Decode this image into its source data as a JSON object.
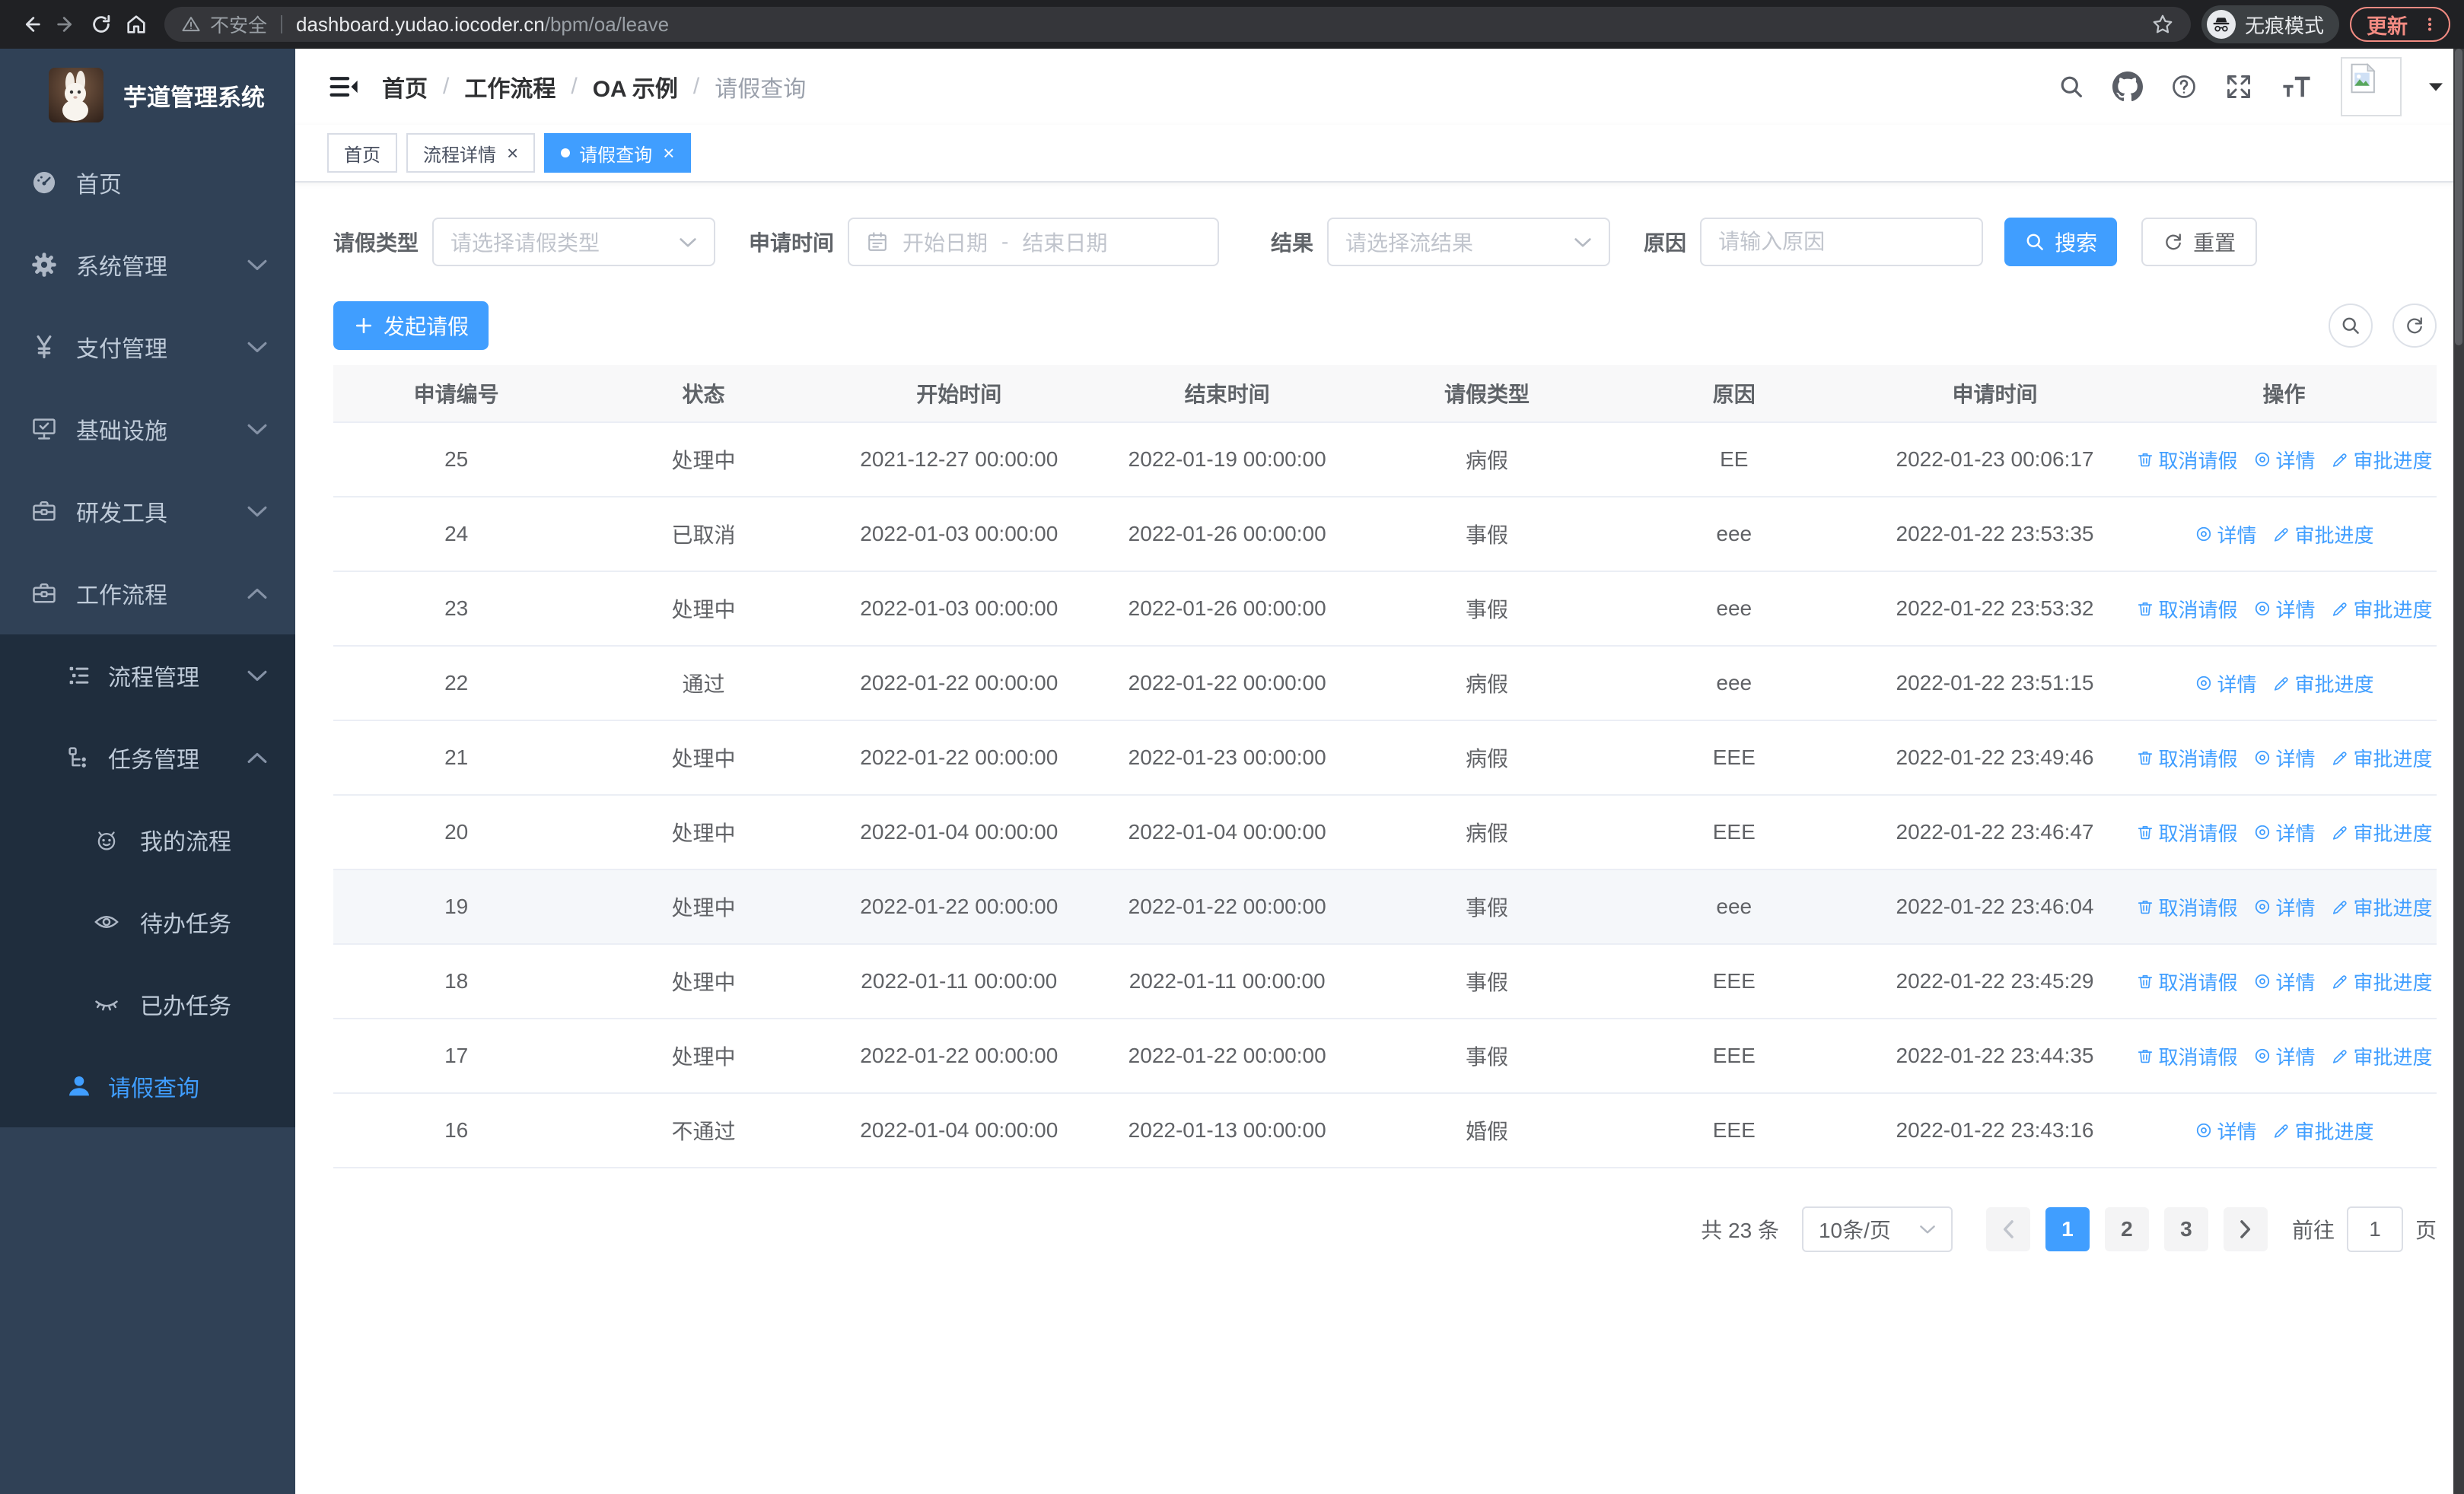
{
  "colors": {
    "primary": "#409eff",
    "sidebar_bg": "#304156",
    "sidebar_submenu_bg": "#1f2d3d",
    "update_accent": "#f28b82",
    "table_header_bg": "#f8f8f9",
    "row_highlight": "#f5f7fa",
    "link": "#409eff"
  },
  "browser": {
    "security_label": "不安全",
    "url_domain": "dashboard.yudao.iocoder.cn",
    "url_path": "/bpm/oa/leave",
    "incognito_label": "无痕模式",
    "update_label": "更新"
  },
  "sidebar": {
    "title": "芋道管理系统",
    "menu": [
      {
        "label": "首页",
        "icon": "dashboard",
        "level": 1
      },
      {
        "label": "系统管理",
        "icon": "gear",
        "level": 1,
        "chevron": "down"
      },
      {
        "label": "支付管理",
        "icon": "yen",
        "level": 1,
        "chevron": "down"
      },
      {
        "label": "基础设施",
        "icon": "monitor",
        "level": 1,
        "chevron": "down"
      },
      {
        "label": "研发工具",
        "icon": "toolbox",
        "level": 1,
        "chevron": "down"
      },
      {
        "label": "工作流程",
        "icon": "toolbox",
        "level": 1,
        "chevron": "up"
      },
      {
        "label": "流程管理",
        "icon": "list",
        "level": 2,
        "sub": true,
        "chevron": "down"
      },
      {
        "label": "任务管理",
        "icon": "tree",
        "level": 2,
        "sub": true,
        "chevron": "up"
      },
      {
        "label": "我的流程",
        "icon": "robot",
        "level": 3,
        "sub": true
      },
      {
        "label": "待办任务",
        "icon": "eye",
        "level": 3,
        "sub": true
      },
      {
        "label": "已办任务",
        "icon": "eye-closed",
        "level": 3,
        "sub": true
      },
      {
        "label": "请假查询",
        "icon": "user",
        "level": 2,
        "sub": true,
        "active": true
      }
    ]
  },
  "topbar": {
    "breadcrumb": [
      "首页",
      "工作流程",
      "OA 示例",
      "请假查询"
    ]
  },
  "tabs": [
    {
      "label": "首页"
    },
    {
      "label": "流程详情",
      "closable": true
    },
    {
      "label": "请假查询",
      "closable": true,
      "active": true
    }
  ],
  "filters": {
    "leave_type_label": "请假类型",
    "leave_type_placeholder": "请选择请假类型",
    "apply_time_label": "申请时间",
    "date_start_placeholder": "开始日期",
    "date_separator": "-",
    "date_end_placeholder": "结束日期",
    "result_label": "结果",
    "result_placeholder": "请选择流结果",
    "reason_label": "原因",
    "reason_placeholder": "请输入原因",
    "search_label": "搜索",
    "reset_label": "重置"
  },
  "toolbar": {
    "create_label": "发起请假"
  },
  "table": {
    "columns": [
      "申请编号",
      "状态",
      "开始时间",
      "结束时间",
      "请假类型",
      "原因",
      "申请时间",
      "操作"
    ],
    "action_labels": {
      "cancel": "取消请假",
      "detail": "详情",
      "progress": "审批进度"
    },
    "rows": [
      {
        "id": "25",
        "status": "处理中",
        "start": "2021-12-27 00:00:00",
        "end": "2022-01-19 00:00:00",
        "type": "病假",
        "reason": "EE",
        "apply_time": "2022-01-23 00:06:17",
        "actions": [
          "cancel",
          "detail",
          "progress"
        ]
      },
      {
        "id": "24",
        "status": "已取消",
        "start": "2022-01-03 00:00:00",
        "end": "2022-01-26 00:00:00",
        "type": "事假",
        "reason": "eee",
        "apply_time": "2022-01-22 23:53:35",
        "actions": [
          "detail",
          "progress"
        ]
      },
      {
        "id": "23",
        "status": "处理中",
        "start": "2022-01-03 00:00:00",
        "end": "2022-01-26 00:00:00",
        "type": "事假",
        "reason": "eee",
        "apply_time": "2022-01-22 23:53:32",
        "actions": [
          "cancel",
          "detail",
          "progress"
        ]
      },
      {
        "id": "22",
        "status": "通过",
        "start": "2022-01-22 00:00:00",
        "end": "2022-01-22 00:00:00",
        "type": "病假",
        "reason": "eee",
        "apply_time": "2022-01-22 23:51:15",
        "actions": [
          "detail",
          "progress"
        ]
      },
      {
        "id": "21",
        "status": "处理中",
        "start": "2022-01-22 00:00:00",
        "end": "2022-01-23 00:00:00",
        "type": "病假",
        "reason": "EEE",
        "apply_time": "2022-01-22 23:49:46",
        "actions": [
          "cancel",
          "detail",
          "progress"
        ]
      },
      {
        "id": "20",
        "status": "处理中",
        "start": "2022-01-04 00:00:00",
        "end": "2022-01-04 00:00:00",
        "type": "病假",
        "reason": "EEE",
        "apply_time": "2022-01-22 23:46:47",
        "actions": [
          "cancel",
          "detail",
          "progress"
        ]
      },
      {
        "id": "19",
        "status": "处理中",
        "start": "2022-01-22 00:00:00",
        "end": "2022-01-22 00:00:00",
        "type": "事假",
        "reason": "eee",
        "apply_time": "2022-01-22 23:46:04",
        "actions": [
          "cancel",
          "detail",
          "progress"
        ],
        "highlighted": true
      },
      {
        "id": "18",
        "status": "处理中",
        "start": "2022-01-11 00:00:00",
        "end": "2022-01-11 00:00:00",
        "type": "事假",
        "reason": "EEE",
        "apply_time": "2022-01-22 23:45:29",
        "actions": [
          "cancel",
          "detail",
          "progress"
        ]
      },
      {
        "id": "17",
        "status": "处理中",
        "start": "2022-01-22 00:00:00",
        "end": "2022-01-22 00:00:00",
        "type": "事假",
        "reason": "EEE",
        "apply_time": "2022-01-22 23:44:35",
        "actions": [
          "cancel",
          "detail",
          "progress"
        ]
      },
      {
        "id": "16",
        "status": "不通过",
        "start": "2022-01-04 00:00:00",
        "end": "2022-01-13 00:00:00",
        "type": "婚假",
        "reason": "EEE",
        "apply_time": "2022-01-22 23:43:16",
        "actions": [
          "detail",
          "progress"
        ]
      }
    ]
  },
  "pagination": {
    "total_label": "共 23 条",
    "page_size": "10条/页",
    "pages": [
      {
        "label": "1",
        "active": true
      },
      {
        "label": "2"
      },
      {
        "label": "3"
      }
    ],
    "goto_label": "前往",
    "goto_value": "1",
    "goto_suffix": "页"
  }
}
